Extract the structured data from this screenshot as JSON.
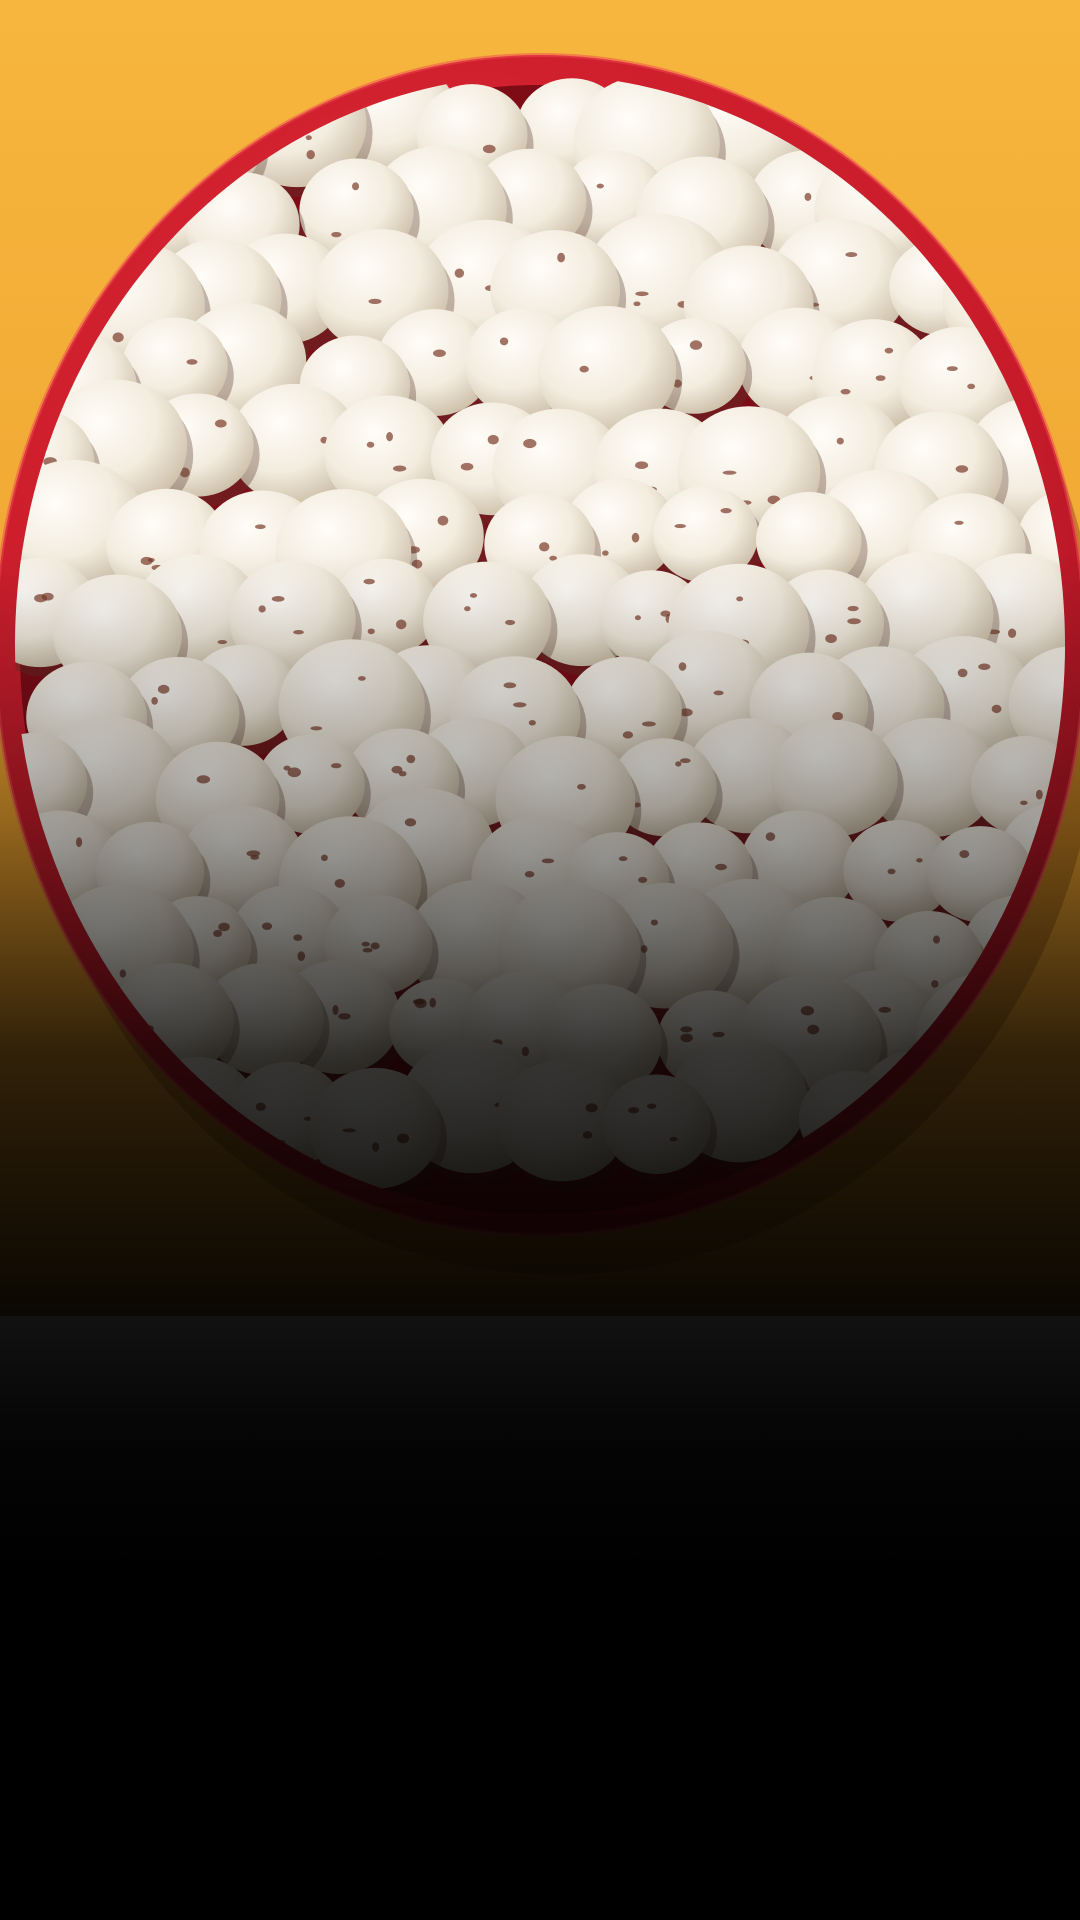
{
  "scene": {
    "subject": "bowl-of-makhana",
    "colors": {
      "backdrop_top": "#f5b13a",
      "backdrop_mid": "#e39a2a",
      "bowl_red": "#c81b2a",
      "bowl_rim_dark": "#8e0f1c",
      "seed_light": "#f7f1e6",
      "seed_shadow": "#cfc3ae",
      "seed_speck": "#7a3b2a",
      "overlay_dark": "#000000"
    }
  }
}
